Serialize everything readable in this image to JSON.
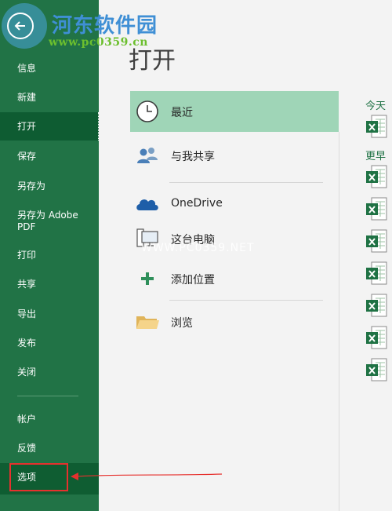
{
  "watermark": {
    "title": "河东软件园",
    "url": "www.pc0359.cn",
    "center_text": "WWW.PC0359.NET"
  },
  "sidebar": {
    "items": [
      {
        "label": "信息"
      },
      {
        "label": "新建"
      },
      {
        "label": "打开"
      },
      {
        "label": "保存"
      },
      {
        "label": "另存为"
      },
      {
        "label": "另存为 Adobe PDF"
      },
      {
        "label": "打印"
      },
      {
        "label": "共享"
      },
      {
        "label": "导出"
      },
      {
        "label": "发布"
      },
      {
        "label": "关闭"
      },
      {
        "label": "帐户"
      },
      {
        "label": "反馈"
      },
      {
        "label": "选项"
      }
    ],
    "selected_item": "打开",
    "highlighted_item": "选项"
  },
  "main": {
    "title": "打开",
    "locations": [
      {
        "label": "最近",
        "icon": "clock-icon"
      },
      {
        "label": "与我共享",
        "icon": "people-icon"
      },
      {
        "label": "OneDrive",
        "icon": "cloud-icon"
      },
      {
        "label": "这台电脑",
        "icon": "computer-icon"
      },
      {
        "label": "添加位置",
        "icon": "plus-icon"
      },
      {
        "label": "浏览",
        "icon": "folder-icon"
      }
    ]
  },
  "recent": {
    "groups": [
      {
        "label": "今天",
        "files": 1
      },
      {
        "label": "更早",
        "files": 7
      }
    ]
  },
  "colors": {
    "sidebar": "#217346",
    "sidebar_selected": "#0e5c32",
    "location_selected": "#9fd5b7",
    "annotation_red": "#e6312e"
  }
}
